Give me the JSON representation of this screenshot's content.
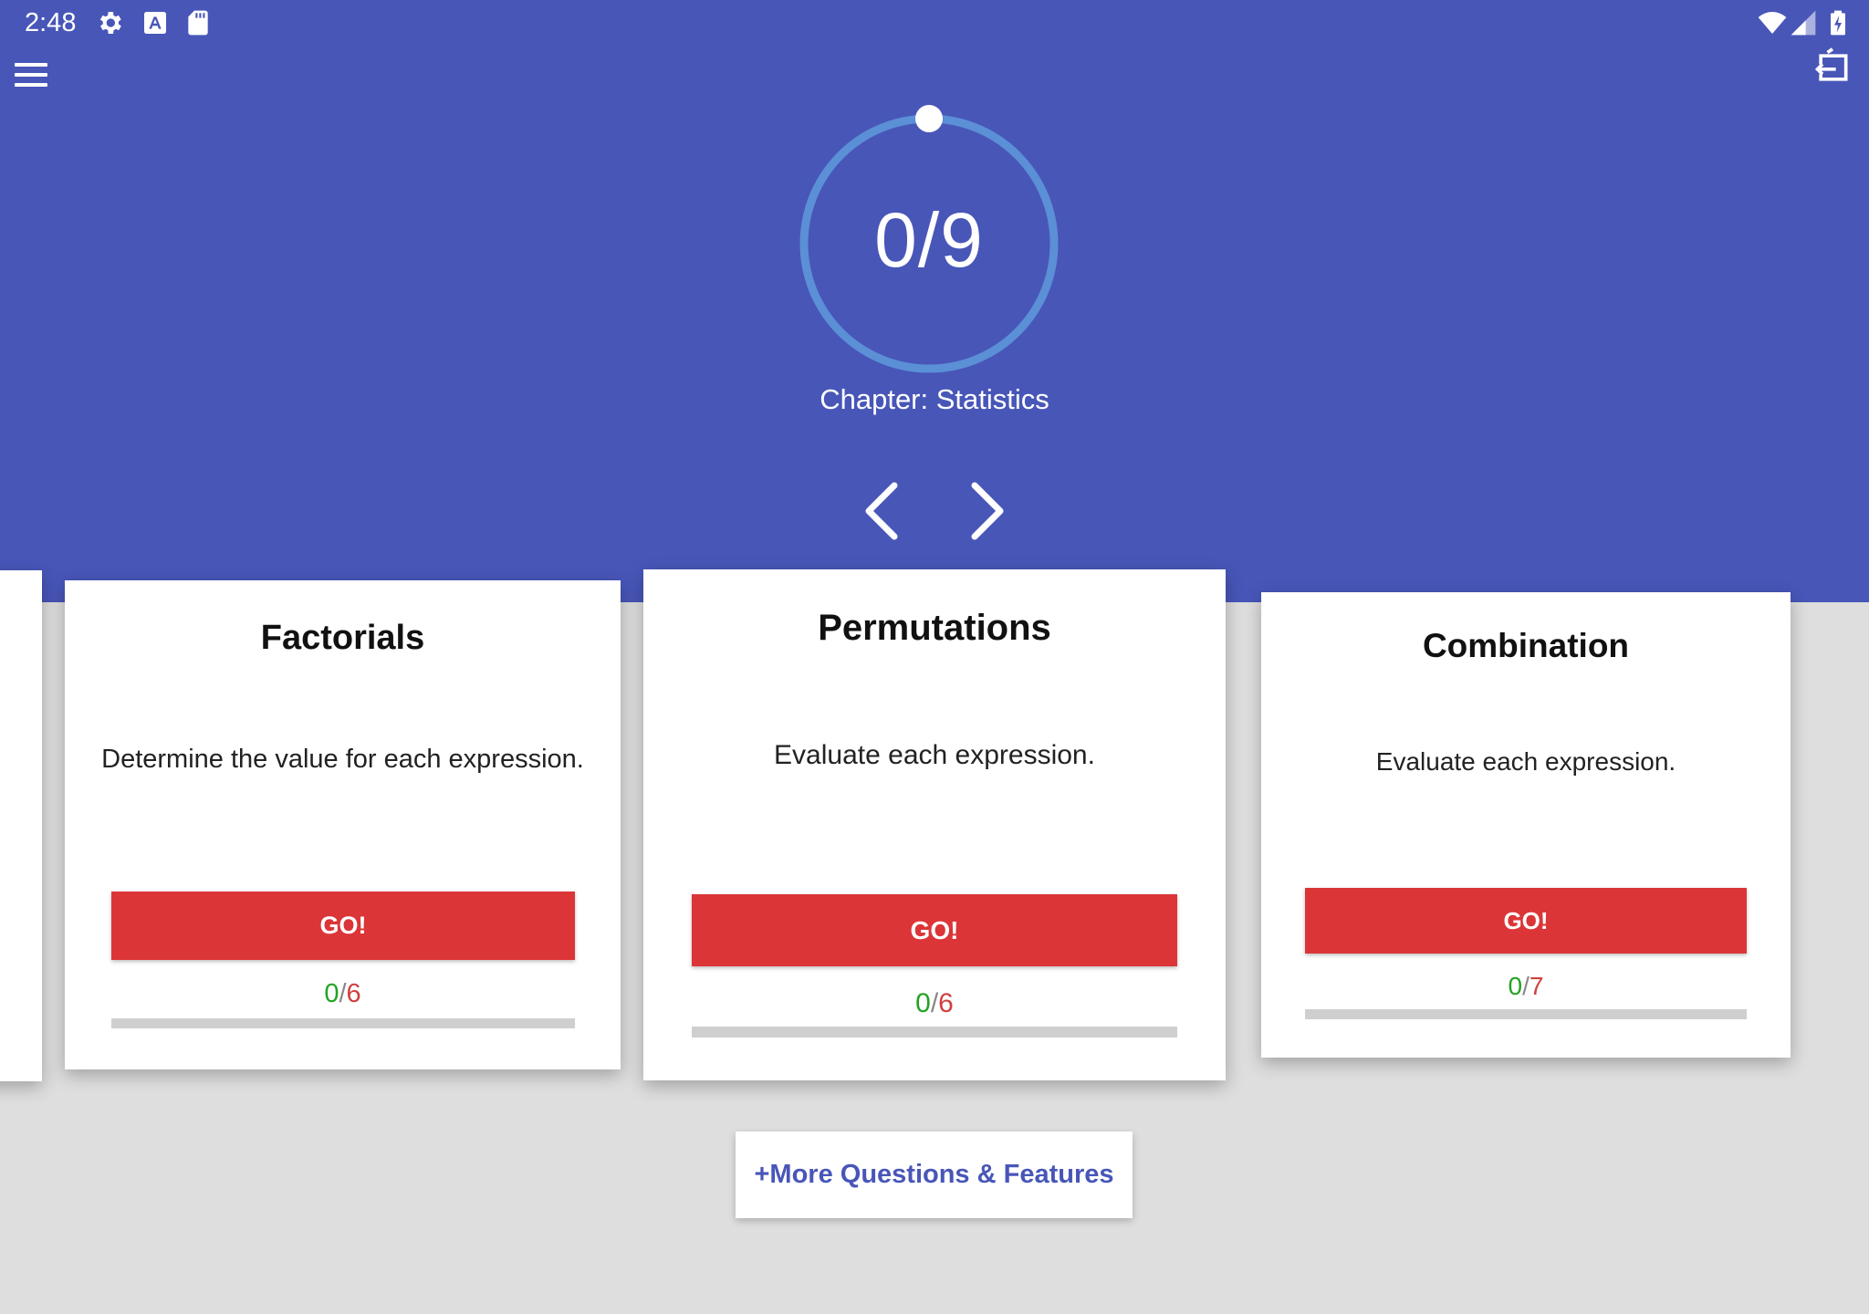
{
  "status_bar": {
    "time": "2:48",
    "left_icons": [
      "settings-icon",
      "font-a-icon",
      "sd-card-icon"
    ],
    "right_icons": [
      "wifi-icon",
      "cell-signal-icon",
      "battery-charging-icon"
    ]
  },
  "toolbar": {
    "menu_icon": "hamburger-menu-icon",
    "exit_icon": "exit-to-app-icon"
  },
  "progress": {
    "label": "0/9",
    "completed": 0,
    "total": 9,
    "chapter": "Chapter: Statistics"
  },
  "nav": {
    "prev_icon": "chevron-left-icon",
    "next_icon": "chevron-right-icon"
  },
  "cards": [
    {
      "title": "Factorials",
      "description": "Determine the value for each expression.",
      "button": "GO!",
      "correct": "0",
      "sep": "/",
      "total": "6",
      "progress_fraction": 0
    },
    {
      "title": "Permutations",
      "description": "Evaluate each expression.",
      "button": "GO!",
      "correct": "0",
      "sep": "/",
      "total": "6",
      "progress_fraction": 0
    },
    {
      "title": "Combination",
      "description": "Evaluate each expression.",
      "button": "GO!",
      "correct": "0",
      "sep": "/",
      "total": "7",
      "progress_fraction": 0
    }
  ],
  "more_button": "+More Questions & Features",
  "colors": {
    "header": "#4856b8",
    "ring": "#5b8fd6",
    "go_button": "#dc3538",
    "correct": "#23a323",
    "total": "#d04040",
    "background": "#dedede"
  }
}
